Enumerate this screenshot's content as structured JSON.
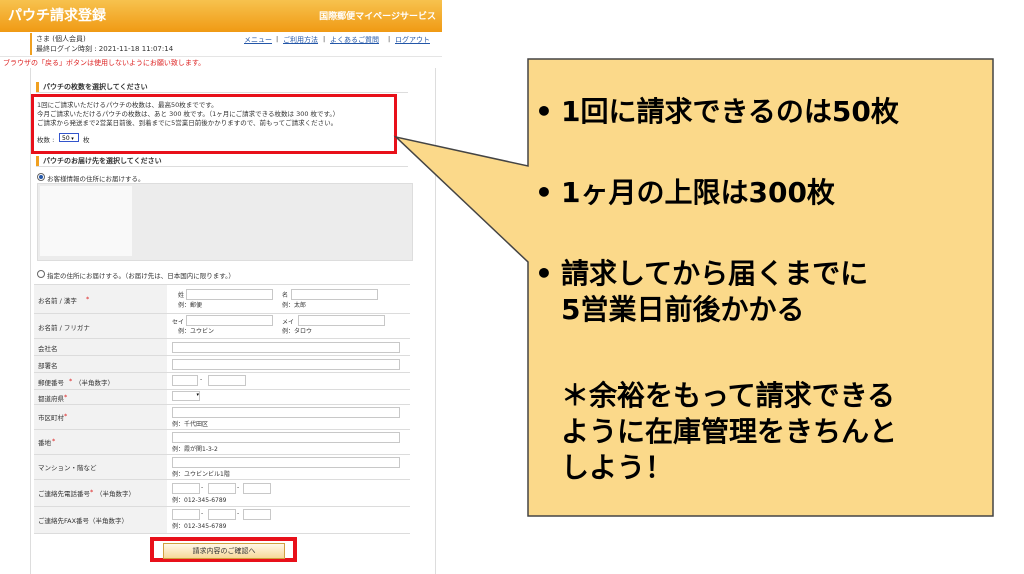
{
  "header": {
    "title": "パウチ請求登録",
    "service": "国際郵便マイページサービス"
  },
  "user": {
    "name": "さま (個人会員)",
    "last_login": "最終ログイン時刻 : 2021-11-18 11:07:14"
  },
  "nav": [
    "メニュー",
    "ご利用方法",
    "よくあるご質問",
    "ログアウト"
  ],
  "warning": "ブラウザの「戻る」ボタンは使用しないようにお願い致します。",
  "section_count": {
    "title": "パウチの枚数を選択してください",
    "line1": "1回にご請求いただけるパウチの枚数は、最高50枚までです。",
    "line2": "今月ご請求いただけるパウチの枚数は、あと 300 枚です。（1ヶ月にご請求できる枚数は 300 枚です。）",
    "line3": "ご請求から発送まで2営業日前後、到着までに5営業日前後かかりますので、前もってご請求ください。",
    "count_label": "枚数 :",
    "count_value": "50",
    "count_unit": "枚"
  },
  "section_address": {
    "title": "パウチのお届け先を選択してください",
    "option_registered": "お客様情報の住所にお届けする。",
    "option_specified": "指定の住所にお届けする。（お届け先は、日本国内に限ります。）"
  },
  "form": {
    "name_kanji": {
      "label": "お名前 / 漢字",
      "sei": "姓",
      "mei": "名",
      "ex_sei": "例：郵便",
      "ex_mei": "例：太郎"
    },
    "name_kana": {
      "label": "お名前 / フリガナ",
      "sei": "セイ",
      "mei": "メイ",
      "ex_sei": "例：ユウビン",
      "ex_mei": "例：タロウ"
    },
    "company": {
      "label": "会社名"
    },
    "department": {
      "label": "部署名"
    },
    "postal": {
      "label": "郵便番号",
      "note": "（半角数字）",
      "dash": "-"
    },
    "prefecture": {
      "label": "都道府県"
    },
    "city": {
      "label": "市区町村",
      "example": "例：千代田区"
    },
    "street": {
      "label": "番地",
      "example": "例：霞が関1-3-2"
    },
    "building": {
      "label": "マンション・階など",
      "example": "例：ユウビンビル1階"
    },
    "phone": {
      "label": "ご連絡先電話番号",
      "note": "（半角数字）",
      "example": "例：012-345-6789",
      "dash": "-"
    },
    "fax": {
      "label": "ご連絡先FAX番号（半角数字）",
      "example": "例：012-345-6789",
      "dash": "-"
    },
    "required_mark": "*",
    "confirm": "請求内容のご確認へ"
  },
  "callout": {
    "bullet": "•",
    "point1": "1回に請求できるのは50枚",
    "point2": "1ヶ月の上限は300枚",
    "point3_line1": "請求してから届くまでに",
    "point3_line2": "5営業日前後かかる",
    "note_line1": "＊余裕をもって請求できる",
    "note_line2": "ように在庫管理をきちんと",
    "note_line3": "しよう！",
    "bg_color": "#fbd98a",
    "border_color": "#444444"
  },
  "colors": {
    "header_orange": "#f09a14",
    "highlight_red": "#e8101a",
    "link_blue": "#2457a8"
  }
}
